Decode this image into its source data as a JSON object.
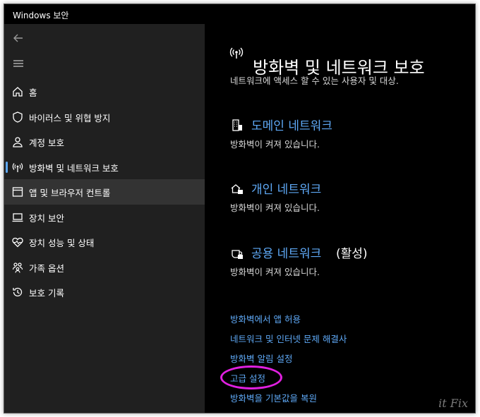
{
  "window": {
    "title": "Windows 보안"
  },
  "sidebar": {
    "items": [
      {
        "label": "홈",
        "icon": "home-icon"
      },
      {
        "label": "바이러스 및 위협 방지",
        "icon": "shield-icon"
      },
      {
        "label": "계정 보호",
        "icon": "person-icon"
      },
      {
        "label": "방화벽 및 네트워크 보호",
        "icon": "antenna-icon"
      },
      {
        "label": "앱 및 브라우저 컨트롤",
        "icon": "app-window-icon"
      },
      {
        "label": "장치 보안",
        "icon": "laptop-icon"
      },
      {
        "label": "장치 성능 및 상태",
        "icon": "heart-pulse-icon"
      },
      {
        "label": "가족 옵션",
        "icon": "family-icon"
      },
      {
        "label": "보호 기록",
        "icon": "history-icon"
      }
    ]
  },
  "main": {
    "title": "방화벽 및 네트워크 보호",
    "subtitle": "네트워크에 액세스 할 수 있는 사용자 및 대상.",
    "networks": [
      {
        "name": "도메인 네트워크",
        "status": "방화벽이 켜져 있습니다.",
        "tag": "",
        "icon": "domain-network-icon"
      },
      {
        "name": "개인 네트워크",
        "status": "방화벽이 켜져 있습니다.",
        "tag": "",
        "icon": "private-network-icon"
      },
      {
        "name": "공용 네트워크",
        "status": "방화벽이 켜져 있습니다.",
        "tag": "(활성)",
        "icon": "public-network-icon"
      }
    ],
    "links": [
      "방화벽에서 앱 허용",
      "네트워크 및 인터넷 문제 해결사",
      "방화벽 알림 설정",
      "고급 설정",
      "방화벽을 기본값을 복원"
    ]
  },
  "watermark": "it Fix",
  "colors": {
    "accent": "#5ea8f5",
    "highlight_ring": "#e020e0",
    "sidebar_bg": "#202020",
    "main_bg": "#000000"
  }
}
